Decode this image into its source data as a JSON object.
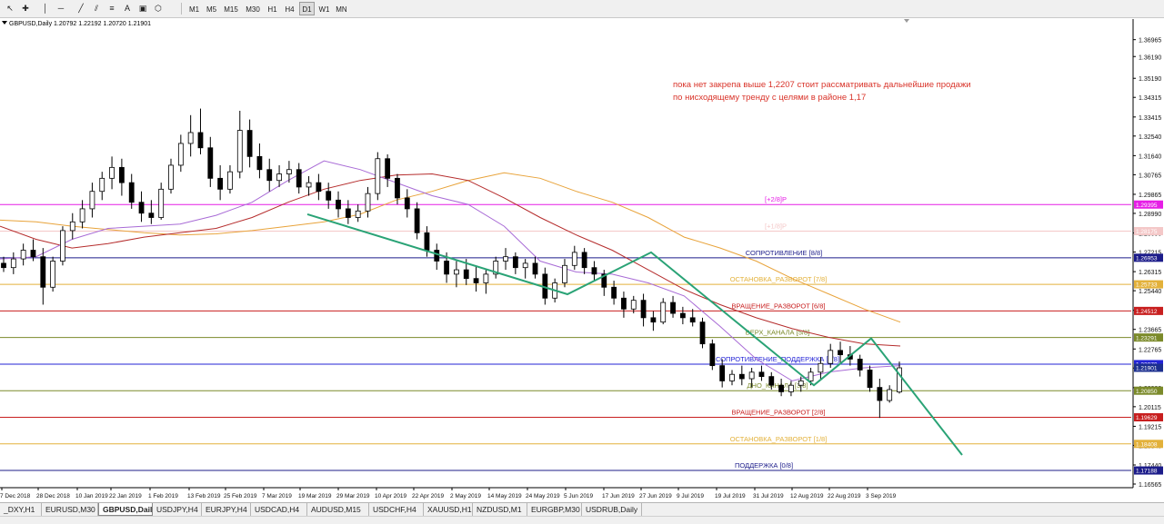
{
  "toolbar": {
    "tools": [
      {
        "name": "cursor-icon",
        "glyph": "↖"
      },
      {
        "name": "crosshair-icon",
        "glyph": "✚"
      },
      {
        "name": "vertical-line-icon",
        "glyph": "│"
      },
      {
        "name": "horizontal-line-icon",
        "glyph": "─"
      },
      {
        "name": "trendline-icon",
        "glyph": "╱"
      },
      {
        "name": "channel-icon",
        "glyph": "⫽"
      },
      {
        "name": "fibonacci-icon",
        "glyph": "≡"
      },
      {
        "name": "text-icon",
        "glyph": "A"
      },
      {
        "name": "label-icon",
        "glyph": "▣"
      },
      {
        "name": "shapes-icon",
        "glyph": "⬡"
      }
    ],
    "timeframes": [
      "M1",
      "M5",
      "M15",
      "M30",
      "H1",
      "H4",
      "D1",
      "W1",
      "MN"
    ],
    "active_timeframe": "D1"
  },
  "symbol_info": "GBPUSD,Daily  1.20792 1.22192 1.20720 1.21901",
  "annotation": {
    "line1": "пока нет закрепа выше 1,2207 стоит рассматривать дальнейшие продажи",
    "line2": "по нисходящему тренду с целями в районе 1,17",
    "color": "#d9342a"
  },
  "chart_data": {
    "type": "candlestick",
    "symbol": "GBPUSD",
    "timeframe": "Daily",
    "ohlc_last": {
      "open": 1.20792,
      "high": 1.22192,
      "low": 1.2072,
      "close": 1.21901
    },
    "ylim": [
      1.16565,
      1.37743
    ],
    "price_ticks": [
      1.36965,
      1.3619,
      1.3519,
      1.34315,
      1.33415,
      1.3254,
      1.3164,
      1.30765,
      1.29865,
      1.2899,
      1.2809,
      1.27215,
      1.26315,
      1.2544,
      1.2454,
      1.23665,
      1.22765,
      1.2189,
      1.2099,
      1.20115,
      1.19215,
      1.1834,
      1.1744,
      1.16565
    ],
    "date_ticks": [
      "7 Dec 2018",
      "28 Dec 2018",
      "10 Jan 2019",
      "22 Jan 2019",
      "1 Feb 2019",
      "13 Feb 2019",
      "25 Feb 2019",
      "7 Mar 2019",
      "19 Mar 2019",
      "29 Mar 2019",
      "10 Apr 2019",
      "22 Apr 2019",
      "2 May 2019",
      "14 May 2019",
      "24 May 2019",
      "5 Jun 2019",
      "17 Jun 2019",
      "27 Jun 2019",
      "9 Jul 2019",
      "19 Jul 2019",
      "31 Jul 2019",
      "12 Aug 2019",
      "22 Aug 2019",
      "3 Sep 2019"
    ],
    "levels": [
      {
        "label": "[+2/8]P",
        "price": 1.29395,
        "color": "#e61ee6",
        "tag": "1.29395"
      },
      {
        "label": "[+1/8]P",
        "price": 1.28175,
        "color": "#f4c8c8",
        "tag": "1.28175"
      },
      {
        "label": "СОПРОТИВЛЕНИЕ [8/8]",
        "price": 1.26953,
        "color": "#1c1c8a",
        "tag": "1.26953"
      },
      {
        "label": "ОСТАНОВКА_РАЗВОРОТ [7/8]",
        "price": 1.25733,
        "color": "#e3b13a",
        "tag": "1.25733"
      },
      {
        "label": "ВРАЩЕНИЕ_РАЗВОРОТ [6/8]",
        "price": 1.24512,
        "color": "#c81f1f",
        "tag": "1.24512"
      },
      {
        "label": "ВЕРХ_КАНАЛА [5/8]",
        "price": 1.23291,
        "color": "#7b8a2a",
        "tag": "1.23291"
      },
      {
        "label": "СОПРОТИВЛЕНИЕ_ПОДДЕРЖКА [4/8]",
        "price": 1.2207,
        "color": "#2323d6",
        "tag": "1.22070"
      },
      {
        "label": "ДНО_КАНАЛА [3/8]",
        "price": 1.2085,
        "color": "#7b8a2a",
        "tag": "1.20850"
      },
      {
        "label": "ВРАЩЕНИЕ_РАЗВОРОТ [2/8]",
        "price": 1.19629,
        "color": "#c81f1f",
        "tag": "1.19629"
      },
      {
        "label": "ОСТАНОВКА_РАЗВОРОТ [1/8]",
        "price": 1.18408,
        "color": "#e3b13a",
        "tag": "1.18408"
      },
      {
        "label": "ПОДДЕРЖКА [0/8]",
        "price": 1.17188,
        "color": "#1c1c8a",
        "tag": "1.17188"
      }
    ],
    "current_price": {
      "value": 1.21901,
      "tag": "1.21901"
    },
    "trend_path_dates": [
      "19 Mar 2019",
      "24 May 2019",
      "20 Jun 2019",
      "2 Aug 2019",
      "22 Aug 2019",
      "12 Sep 2019"
    ],
    "trend_path_prices": [
      1.2895,
      1.2528,
      1.272,
      1.211,
      1.2325,
      1.179
    ],
    "ma_series": [
      {
        "color": "#e8a33a",
        "points": [
          [
            1.2868,
            1.286,
            1.284,
            1.2825,
            1.281,
            1.28,
            1.2805,
            1.282,
            1.284,
            1.286,
            1.2895,
            1.296,
            1.3,
            1.305,
            1.3085,
            1.306,
            1.3,
            1.295,
            1.288,
            1.279,
            1.274,
            1.268,
            1.26,
            1.253,
            1.246,
            1.24
          ]
        ]
      },
      {
        "color": "#b52c2c",
        "points": [
          [
            1.284,
            1.278,
            1.274,
            1.276,
            1.279,
            1.281,
            1.283,
            1.288,
            1.295,
            1.301,
            1.305,
            1.3075,
            1.308,
            1.305,
            1.297,
            1.288,
            1.28,
            1.273,
            1.264,
            1.255,
            1.248,
            1.242,
            1.237,
            1.233,
            1.23,
            1.229
          ]
        ]
      },
      {
        "color": "#a86bd6",
        "points": [
          [
            1.269,
            1.27,
            1.278,
            1.283,
            1.284,
            1.285,
            1.289,
            1.295,
            1.305,
            1.314,
            1.31,
            1.304,
            1.298,
            1.294,
            1.284,
            1.268,
            1.263,
            1.262,
            1.258,
            1.252,
            1.238,
            1.223,
            1.213,
            1.217,
            1.219,
            1.22
          ]
        ]
      }
    ],
    "candles": [
      [
        1.267,
        1.27,
        1.263,
        1.265
      ],
      [
        1.265,
        1.272,
        1.262,
        1.269
      ],
      [
        1.269,
        1.276,
        1.266,
        1.273
      ],
      [
        1.273,
        1.278,
        1.268,
        1.27
      ],
      [
        1.27,
        1.274,
        1.248,
        1.256
      ],
      [
        1.256,
        1.27,
        1.254,
        1.268
      ],
      [
        1.268,
        1.284,
        1.266,
        1.282
      ],
      [
        1.282,
        1.29,
        1.278,
        1.286
      ],
      [
        1.286,
        1.296,
        1.283,
        1.292
      ],
      [
        1.292,
        1.304,
        1.288,
        1.3
      ],
      [
        1.3,
        1.309,
        1.296,
        1.306
      ],
      [
        1.306,
        1.316,
        1.301,
        1.311
      ],
      [
        1.311,
        1.315,
        1.298,
        1.304
      ],
      [
        1.304,
        1.308,
        1.292,
        1.295
      ],
      [
        1.295,
        1.3,
        1.286,
        1.29
      ],
      [
        1.29,
        1.296,
        1.285,
        1.288
      ],
      [
        1.288,
        1.304,
        1.287,
        1.301
      ],
      [
        1.301,
        1.315,
        1.299,
        1.312
      ],
      [
        1.312,
        1.326,
        1.309,
        1.322
      ],
      [
        1.322,
        1.335,
        1.316,
        1.327
      ],
      [
        1.327,
        1.338,
        1.317,
        1.32
      ],
      [
        1.32,
        1.325,
        1.302,
        1.306
      ],
      [
        1.306,
        1.312,
        1.296,
        1.301
      ],
      [
        1.301,
        1.312,
        1.299,
        1.309
      ],
      [
        1.309,
        1.337,
        1.306,
        1.328
      ],
      [
        1.328,
        1.333,
        1.311,
        1.316
      ],
      [
        1.316,
        1.322,
        1.306,
        1.31
      ],
      [
        1.31,
        1.315,
        1.3,
        1.305
      ],
      [
        1.305,
        1.312,
        1.302,
        1.308
      ],
      [
        1.308,
        1.314,
        1.304,
        1.31
      ],
      [
        1.31,
        1.313,
        1.299,
        1.302
      ],
      [
        1.302,
        1.307,
        1.298,
        1.304
      ],
      [
        1.304,
        1.308,
        1.296,
        1.3
      ],
      [
        1.3,
        1.304,
        1.292,
        1.296
      ],
      [
        1.296,
        1.3,
        1.288,
        1.292
      ],
      [
        1.292,
        1.296,
        1.285,
        1.288
      ],
      [
        1.288,
        1.294,
        1.286,
        1.291
      ],
      [
        1.291,
        1.302,
        1.288,
        1.299
      ],
      [
        1.299,
        1.318,
        1.296,
        1.315
      ],
      [
        1.315,
        1.317,
        1.302,
        1.306
      ],
      [
        1.306,
        1.308,
        1.294,
        1.297
      ],
      [
        1.297,
        1.301,
        1.288,
        1.292
      ],
      [
        1.292,
        1.295,
        1.278,
        1.281
      ],
      [
        1.281,
        1.284,
        1.27,
        1.273
      ],
      [
        1.273,
        1.276,
        1.264,
        1.268
      ],
      [
        1.268,
        1.272,
        1.258,
        1.262
      ],
      [
        1.262,
        1.268,
        1.256,
        1.264
      ],
      [
        1.264,
        1.269,
        1.257,
        1.26
      ],
      [
        1.26,
        1.266,
        1.254,
        1.258
      ],
      [
        1.258,
        1.264,
        1.253,
        1.262
      ],
      [
        1.262,
        1.27,
        1.26,
        1.268
      ],
      [
        1.268,
        1.274,
        1.264,
        1.27
      ],
      [
        1.27,
        1.272,
        1.262,
        1.265
      ],
      [
        1.265,
        1.269,
        1.26,
        1.267
      ],
      [
        1.267,
        1.27,
        1.26,
        1.262
      ],
      [
        1.262,
        1.265,
        1.248,
        1.251
      ],
      [
        1.251,
        1.26,
        1.249,
        1.258
      ],
      [
        1.258,
        1.269,
        1.256,
        1.266
      ],
      [
        1.266,
        1.275,
        1.264,
        1.272
      ],
      [
        1.272,
        1.274,
        1.262,
        1.265
      ],
      [
        1.265,
        1.268,
        1.259,
        1.262
      ],
      [
        1.262,
        1.264,
        1.252,
        1.256
      ],
      [
        1.256,
        1.259,
        1.248,
        1.251
      ],
      [
        1.251,
        1.254,
        1.242,
        1.246
      ],
      [
        1.246,
        1.252,
        1.244,
        1.25
      ],
      [
        1.25,
        1.253,
        1.238,
        1.242
      ],
      [
        1.242,
        1.245,
        1.236,
        1.24
      ],
      [
        1.24,
        1.251,
        1.239,
        1.249
      ],
      [
        1.249,
        1.252,
        1.242,
        1.244
      ],
      [
        1.244,
        1.247,
        1.239,
        1.242
      ],
      [
        1.242,
        1.246,
        1.238,
        1.24
      ],
      [
        1.24,
        1.242,
        1.228,
        1.23
      ],
      [
        1.23,
        1.232,
        1.218,
        1.22
      ],
      [
        1.22,
        1.223,
        1.21,
        1.213
      ],
      [
        1.213,
        1.218,
        1.211,
        1.216
      ],
      [
        1.216,
        1.22,
        1.211,
        1.214
      ],
      [
        1.214,
        1.219,
        1.21,
        1.217
      ],
      [
        1.217,
        1.22,
        1.213,
        1.215
      ],
      [
        1.215,
        1.217,
        1.209,
        1.211
      ],
      [
        1.211,
        1.214,
        1.206,
        1.208
      ],
      [
        1.208,
        1.213,
        1.206,
        1.211
      ],
      [
        1.211,
        1.215,
        1.208,
        1.213
      ],
      [
        1.213,
        1.219,
        1.211,
        1.217
      ],
      [
        1.217,
        1.224,
        1.214,
        1.221
      ],
      [
        1.221,
        1.23,
        1.219,
        1.227
      ],
      [
        1.227,
        1.231,
        1.221,
        1.225
      ],
      [
        1.225,
        1.229,
        1.22,
        1.223
      ],
      [
        1.223,
        1.225,
        1.215,
        1.218
      ],
      [
        1.218,
        1.22,
        1.208,
        1.21
      ],
      [
        1.21,
        1.214,
        1.196,
        1.204
      ],
      [
        1.204,
        1.211,
        1.203,
        1.209
      ],
      [
        1.2079,
        1.2219,
        1.2072,
        1.219
      ]
    ]
  },
  "tabs": [
    "_DXY,H1",
    "EURUSD,M30",
    "GBPUSD,Daily",
    "USDJPY,H4",
    "EURJPY,H4",
    "USDCAD,H4",
    "AUDUSD,M15",
    "USDCHF,H4",
    "XAUUSD,H1",
    "NZDUSD,M1",
    "EURGBP,M30",
    "USDRUB,Daily"
  ],
  "active_tab": "GBPUSD,Daily"
}
